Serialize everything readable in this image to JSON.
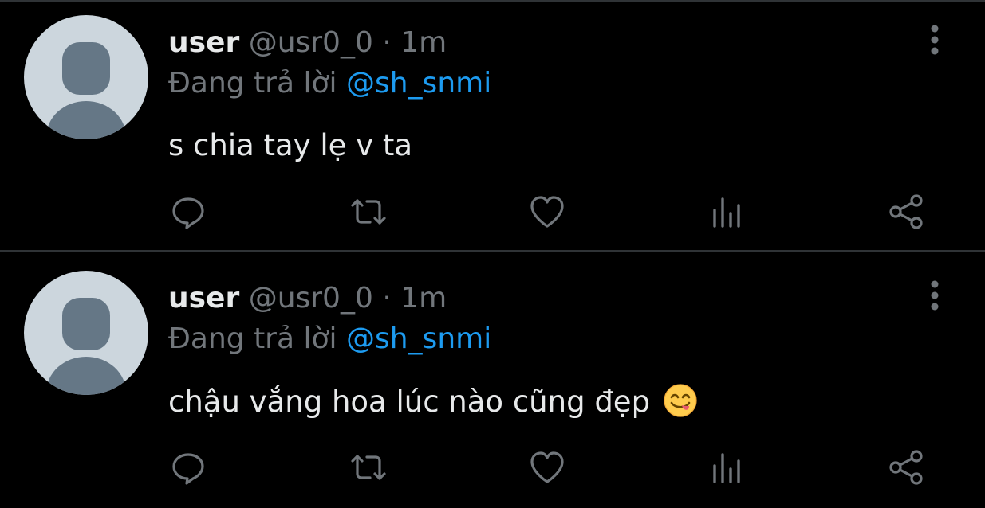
{
  "tweets": [
    {
      "author": {
        "name": "user",
        "handle": "@usr0_0"
      },
      "separator": "·",
      "time": "1m",
      "reply_prefix": "Đang trả lời",
      "reply_to": "@sh_snmi",
      "text": "s chia tay lẹ v ta",
      "emoji": "",
      "actions": [
        "reply-icon",
        "retweet-icon",
        "like-icon",
        "analytics-icon",
        "share-icon"
      ]
    },
    {
      "author": {
        "name": "user",
        "handle": "@usr0_0"
      },
      "separator": "·",
      "time": "1m",
      "reply_prefix": "Đang trả lời",
      "reply_to": "@sh_snmi",
      "text": "chậu vắng hoa lúc nào cũng đẹp",
      "emoji": "face-savoring-food",
      "actions": [
        "reply-icon",
        "retweet-icon",
        "like-icon",
        "analytics-icon",
        "share-icon"
      ]
    }
  ],
  "colors": {
    "background": "#000000",
    "divider": "#2f3336",
    "primary_text": "#e7e9ea",
    "secondary_text": "#71767b",
    "link": "#1d9bf0",
    "avatar_bg": "#ccd6dd",
    "avatar_fg": "#657786"
  }
}
